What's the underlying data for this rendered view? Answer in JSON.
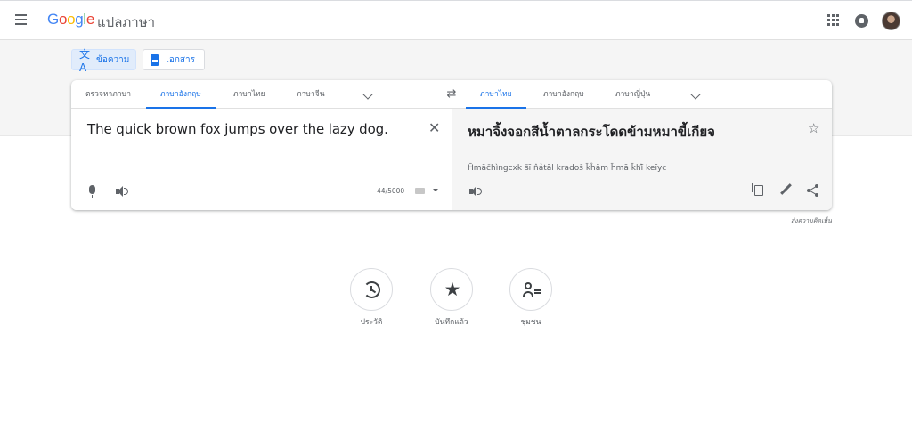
{
  "header": {
    "logo_letters": [
      "G",
      "o",
      "o",
      "g",
      "l",
      "e"
    ],
    "app_name": "แปลภาษา"
  },
  "mode_buttons": {
    "text_label": "ข้อความ",
    "document_label": "เอกสาร"
  },
  "source_languages": {
    "tabs": [
      "ตรวจหาภาษา",
      "ภาษาอังกฤษ",
      "ภาษาไทย",
      "ภาษาจีน"
    ],
    "active_index": 1
  },
  "target_languages": {
    "tabs": [
      "ภาษาไทย",
      "ภาษาอังกฤษ",
      "ภาษาญี่ปุ่น"
    ],
    "active_index": 0
  },
  "source": {
    "text": "The quick brown fox jumps over the lazy dog.",
    "char_count": "44/5000"
  },
  "target": {
    "text": "หมาจิ้งจอกสีน้ำตาลกระโดดข้ามหมาขี้เกียจ",
    "transliteration": "H̄māc̄hìngcxk s̄ī n̂ảtāl krados̄ k̄ĥām h̄mā k̄hī̂ keīyc"
  },
  "feedback_label": "ส่งความคิดเห็น",
  "actions": [
    {
      "label": "ประวัติ",
      "icon": "history-icon"
    },
    {
      "label": "บันทึกแล้ว",
      "icon": "star-icon"
    },
    {
      "label": "ชุมชน",
      "icon": "community-icon"
    }
  ],
  "colors": {
    "accent": "#1a73e8",
    "target_bg": "#f5f5f5",
    "band_bg": "#f5f5f5"
  }
}
